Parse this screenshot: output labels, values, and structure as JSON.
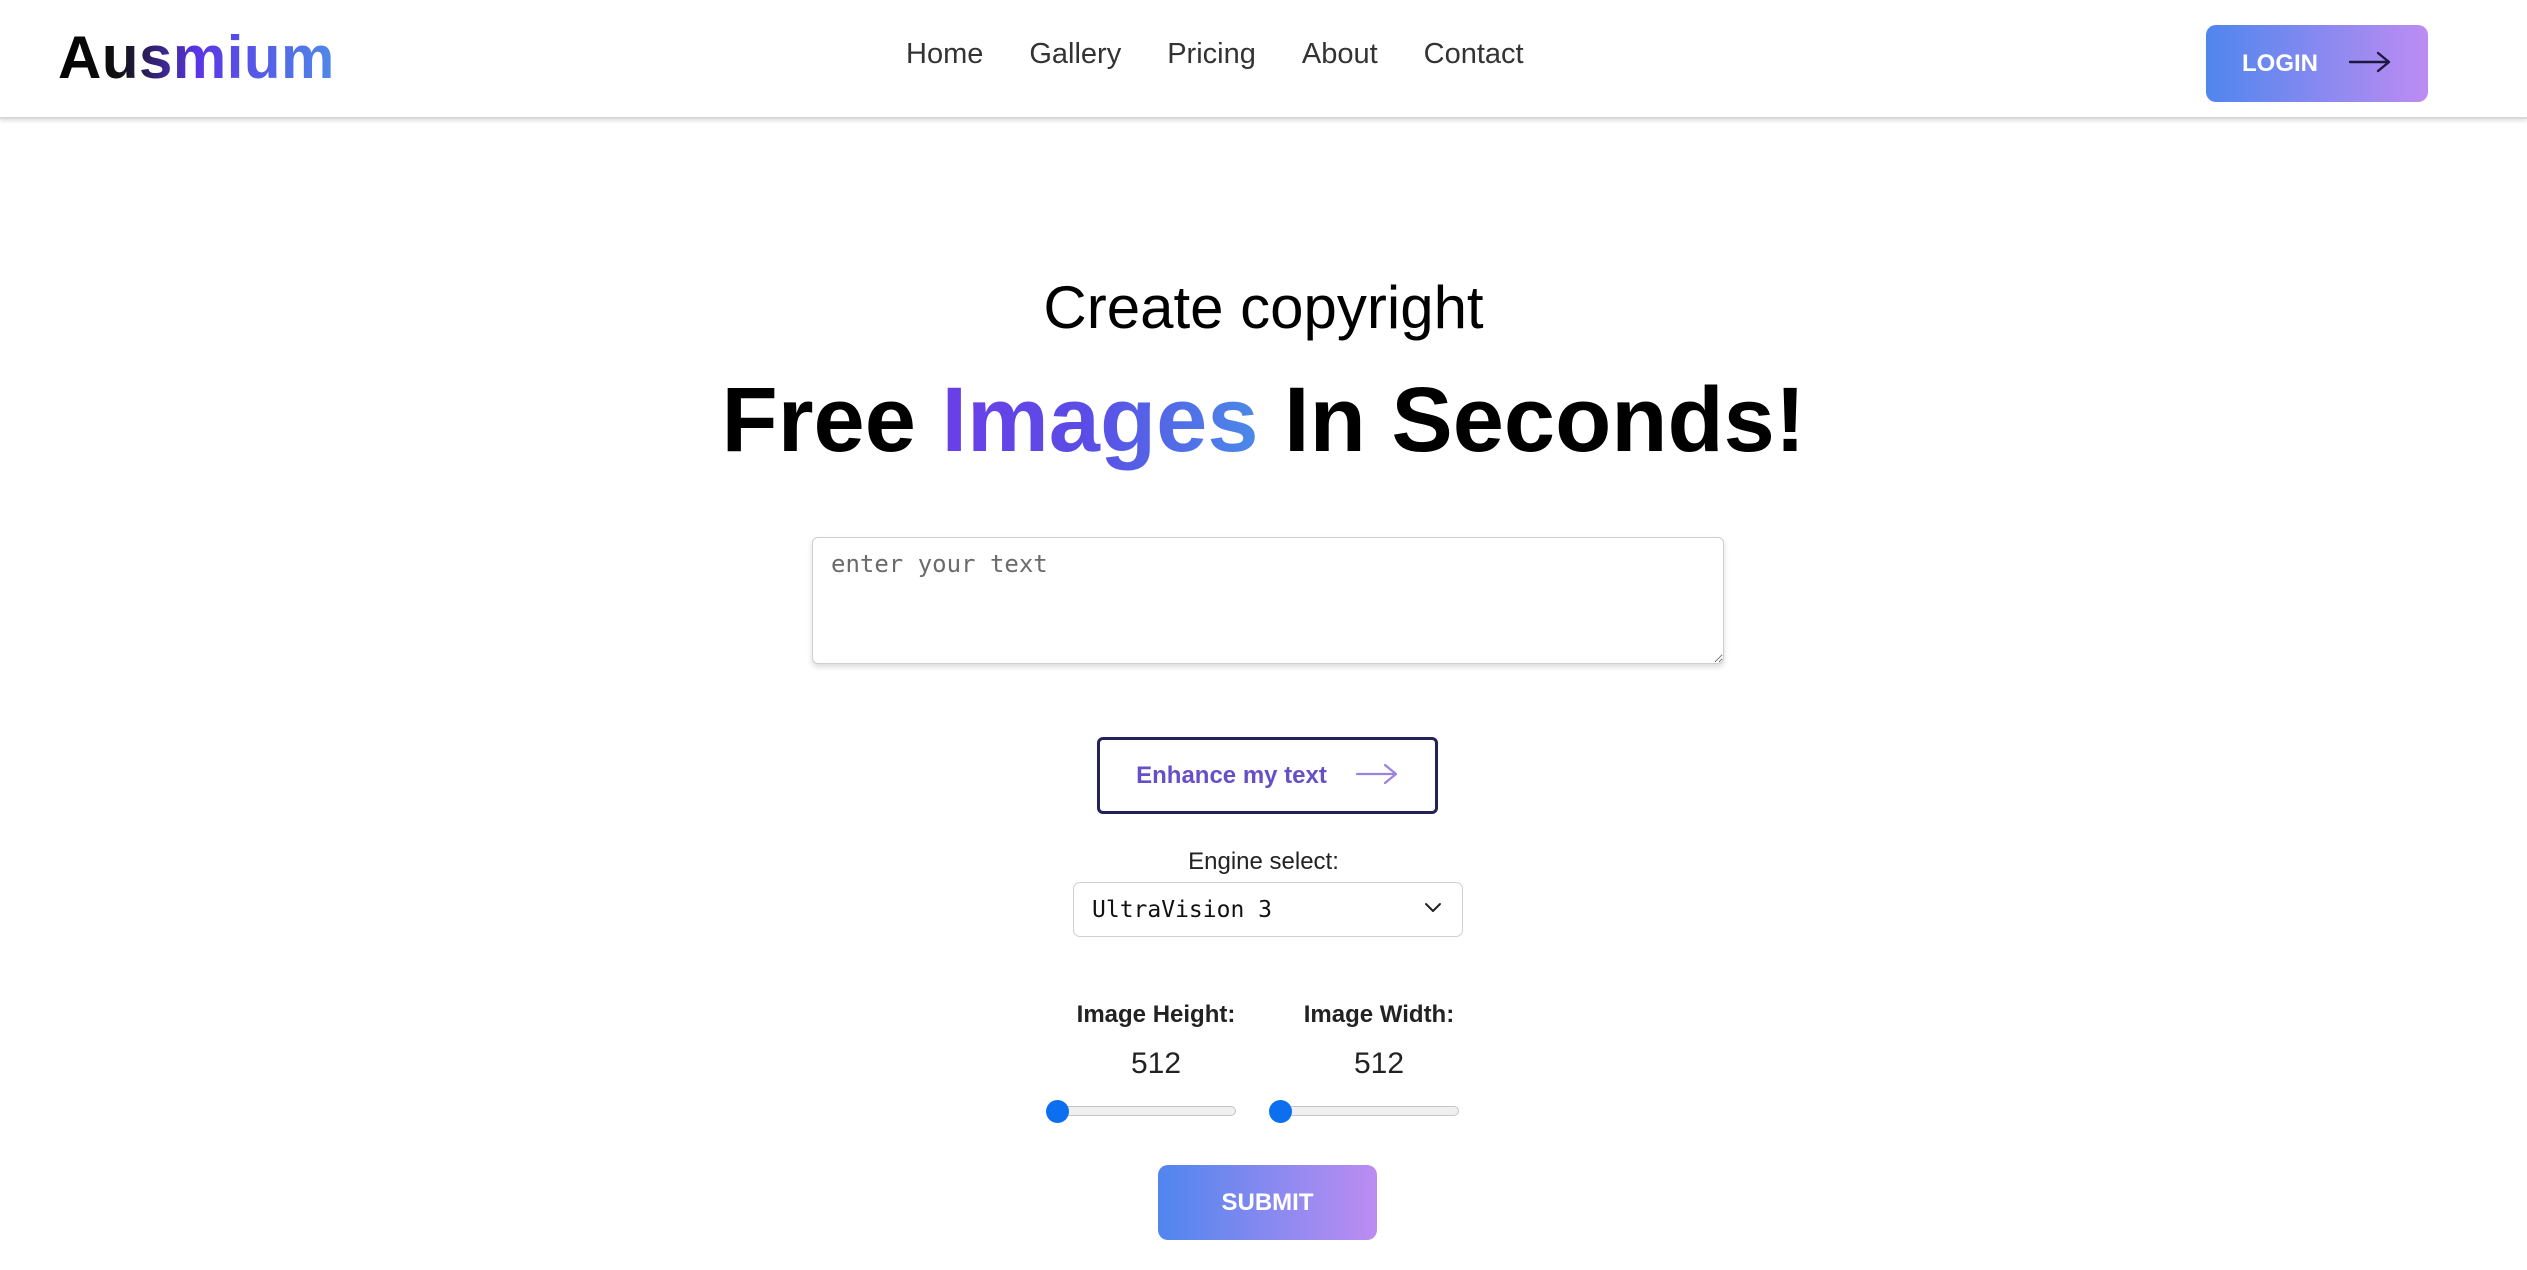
{
  "header": {
    "logo": "Ausmium",
    "nav": [
      "Home",
      "Gallery",
      "Pricing",
      "About",
      "Contact"
    ],
    "login_label": "LOGIN",
    "login_icon": "arrow-right-icon"
  },
  "hero": {
    "subtitle": "Create copyright",
    "title_part1": "Free ",
    "title_highlight": "Images",
    "title_part2": " In Seconds!"
  },
  "form": {
    "prompt_value": "",
    "prompt_placeholder": "enter your text",
    "enhance_label": "Enhance my text",
    "enhance_icon": "arrow-right-icon",
    "engine_label": "Engine select:",
    "engine_selected": "UltraVision 3",
    "engine_icon": "chevron-down-icon",
    "height_label": "Image Height:",
    "height_value": "512",
    "width_label": "Image Width:",
    "width_value": "512",
    "height_slider_fraction": 0.0,
    "width_slider_fraction": 0.0,
    "submit_label": "SUBMIT"
  },
  "colors": {
    "accent_start": "#4f86ee",
    "accent_end": "#bd8cf2",
    "slider_thumb": "#0b6ff0",
    "enhance_border": "#23235a",
    "enhance_text": "#6650c8"
  }
}
